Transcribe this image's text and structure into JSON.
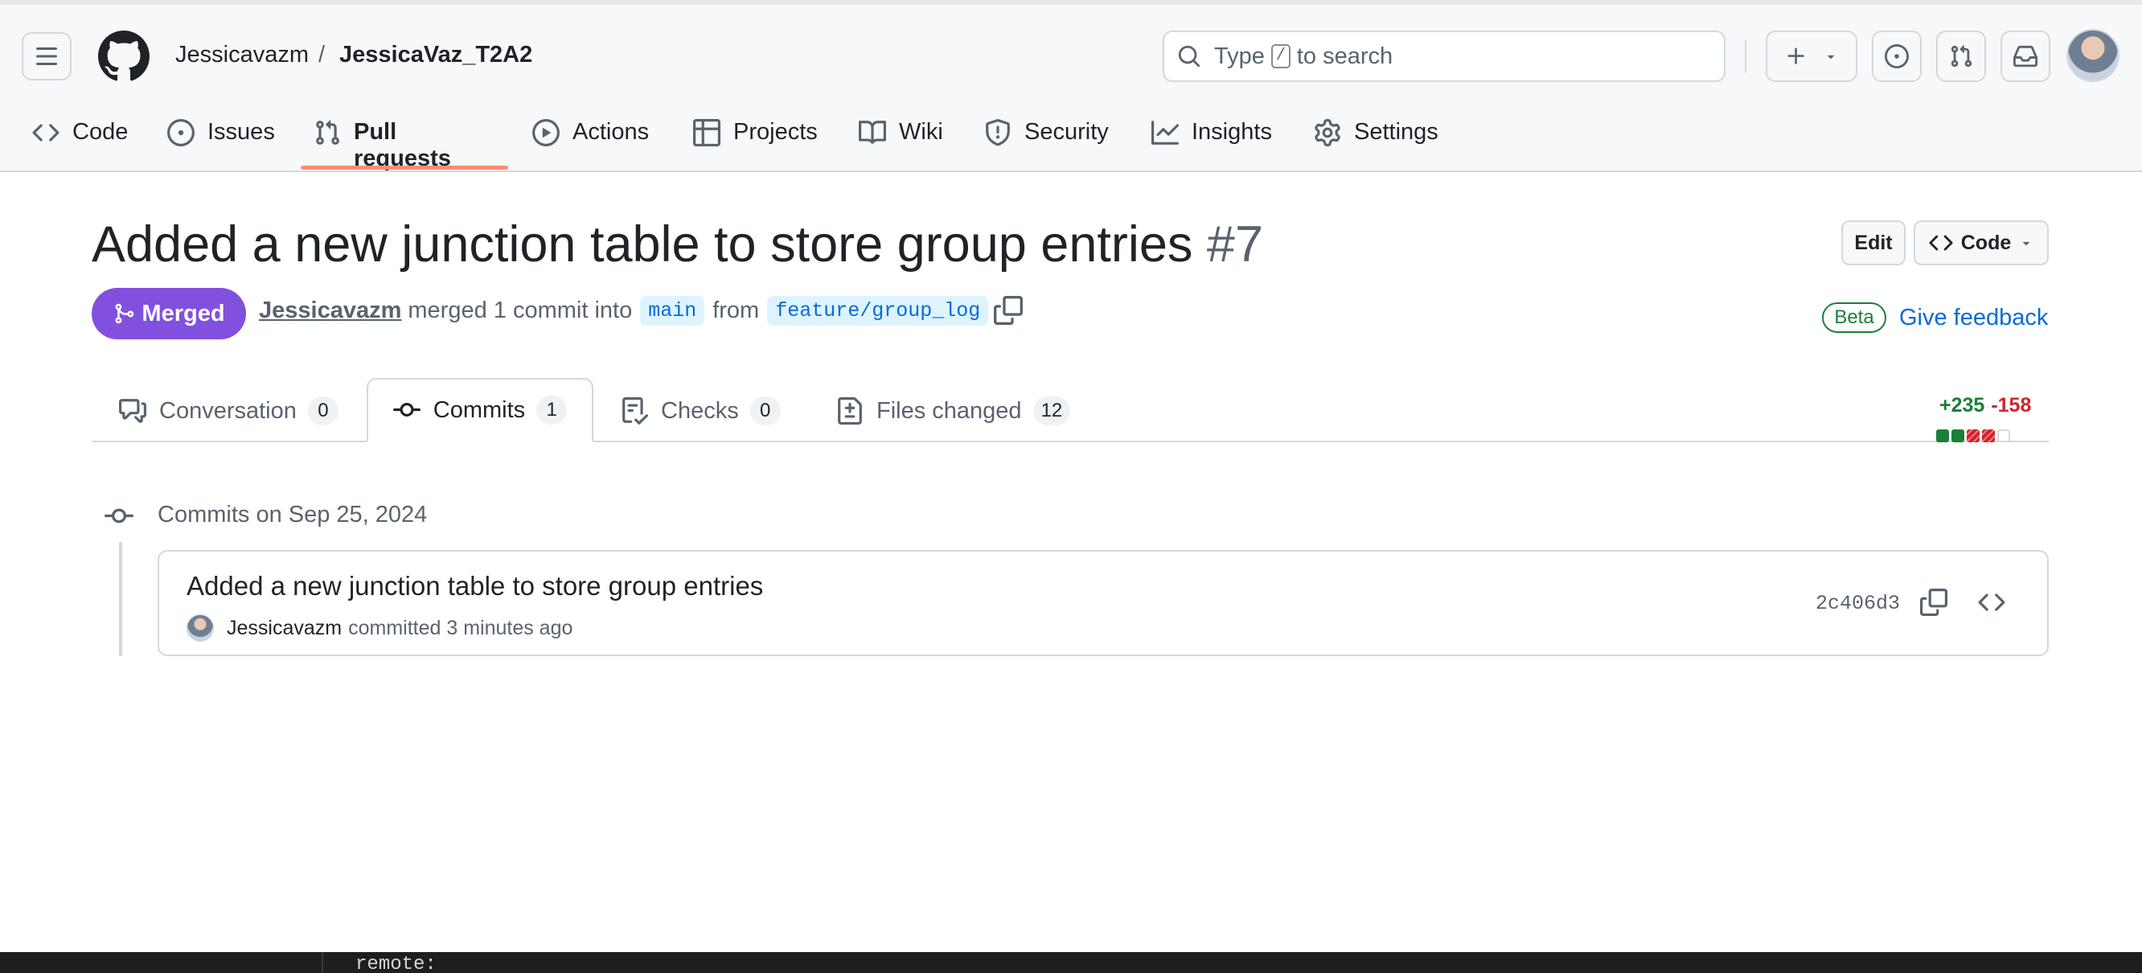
{
  "header": {
    "owner": "Jessicavazm",
    "separator": "/",
    "repo": "JessicaVaz_T2A2",
    "search_prefix": "Type",
    "search_key": "/",
    "search_suffix": "to search"
  },
  "nav": {
    "items": [
      {
        "label": "Code"
      },
      {
        "label": "Issues"
      },
      {
        "label": "Pull requests"
      },
      {
        "label": "Actions"
      },
      {
        "label": "Projects"
      },
      {
        "label": "Wiki"
      },
      {
        "label": "Security"
      },
      {
        "label": "Insights"
      },
      {
        "label": "Settings"
      }
    ],
    "active": "Pull requests"
  },
  "pr": {
    "title": "Added a new junction table to store group entries",
    "number": "#7",
    "state": "Merged",
    "author": "Jessicavazm",
    "merged_text": "merged 1 commit into",
    "base_branch": "main",
    "from_text": "from",
    "head_branch": "feature/group_log",
    "edit_label": "Edit",
    "code_label": "Code",
    "beta_label": "Beta",
    "feedback_label": "Give feedback"
  },
  "tabs": [
    {
      "label": "Conversation",
      "count": "0"
    },
    {
      "label": "Commits",
      "count": "1"
    },
    {
      "label": "Checks",
      "count": "0"
    },
    {
      "label": "Files changed",
      "count": "12"
    }
  ],
  "diffstat": {
    "additions": "+235",
    "deletions": "-158"
  },
  "commits": {
    "group_heading": "Commits on Sep 25, 2024",
    "items": [
      {
        "message": "Added a new junction table to store group entries",
        "author": "Jessicavazm",
        "action": "committed 3 minutes ago",
        "sha": "2c406d3"
      }
    ]
  },
  "terminal": {
    "line": "remote:"
  },
  "colors": {
    "merged": "#8250df",
    "link": "#0969da",
    "additions": "#1a7f37",
    "deletions": "#d1242f",
    "active_tab_underline": "#fd8c73"
  }
}
